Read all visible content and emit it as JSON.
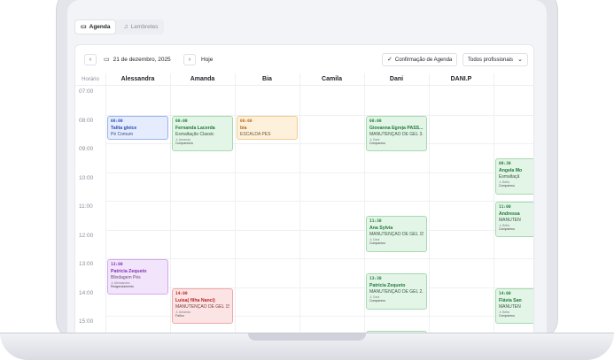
{
  "tabs": [
    {
      "label": "Agenda",
      "icon": "calendar-icon",
      "active": true
    },
    {
      "label": "Lembretes",
      "icon": "bell-icon",
      "active": false
    }
  ],
  "toolbar": {
    "prev": "‹",
    "next": "›",
    "date": "21 de dezembro, 2025",
    "today": "Hoje",
    "confirm": "Confirmação de Agenda",
    "professional_filter": "Todos profissionais"
  },
  "grid": {
    "time_header": "Horário",
    "columns": [
      "Alessandra",
      "Amanda",
      "Bia",
      "Camila",
      "Dani",
      "DANI.P",
      ""
    ],
    "times": [
      "07:00",
      "08:00",
      "09:00",
      "10:00",
      "11:00",
      "12:00",
      "13:00",
      "14:00",
      "15:00"
    ]
  },
  "events": [
    {
      "col": 0,
      "start": 8.0,
      "end": 8.9,
      "color": "blue",
      "time": "08:00",
      "name": "Talita gleice",
      "service": "Pé Comum",
      "pro": "",
      "status": ""
    },
    {
      "col": 1,
      "start": 8.0,
      "end": 9.3,
      "color": "green",
      "time": "08:00",
      "name": "Fernanda Lacerda",
      "service": "Esmaltação Classic",
      "pro": "Amanda",
      "status": "Compareceu"
    },
    {
      "col": 2,
      "start": 8.0,
      "end": 8.9,
      "color": "orange",
      "time": "08:00",
      "name": "bia",
      "service": "ESCALDA PÉS",
      "pro": "",
      "status": ""
    },
    {
      "col": 4,
      "start": 8.0,
      "end": 9.3,
      "color": "green",
      "time": "08:00",
      "name": "Giovanna Egreja PASS...",
      "service": "MANUTENÇÃO DE GEL 3...",
      "pro": "Dani",
      "status": "Comparecu"
    },
    {
      "col": 6,
      "start": 9.5,
      "end": 10.8,
      "color": "green",
      "time": "09:30",
      "name": "Angela Mo",
      "service": "Esmaltaçã",
      "pro": "Bella",
      "status": "Comparecu"
    },
    {
      "col": 6,
      "start": 11.0,
      "end": 12.3,
      "color": "green",
      "time": "11:00",
      "name": "Andressa",
      "service": "MANUTEN",
      "pro": "Bella",
      "status": "Comparecu"
    },
    {
      "col": 4,
      "start": 11.5,
      "end": 12.8,
      "color": "green",
      "time": "11:30",
      "name": "Ana Sylvia",
      "service": "MANUTENÇÃO DE GEL 15...",
      "pro": "Dani",
      "status": "Comparecu"
    },
    {
      "col": 0,
      "start": 13.0,
      "end": 14.3,
      "color": "purple",
      "time": "13:00",
      "name": "Patricia Zequeto",
      "service": "Blindagem Pés",
      "pro": "Alessandra",
      "status": "Reagendamento"
    },
    {
      "col": 4,
      "start": 13.5,
      "end": 14.8,
      "color": "green",
      "time": "13:30",
      "name": "Patricia Zequeto",
      "service": "MANUTENÇÃO DE GEL 2...",
      "pro": "Dani",
      "status": "Comparecu"
    },
    {
      "col": 1,
      "start": 14.0,
      "end": 15.3,
      "color": "red",
      "time": "14:00",
      "name": "Luisa( filha Nanci)",
      "service": "MANUTENÇÃO DE GEL 15...",
      "pro": "Amanda",
      "status": "Faltou"
    },
    {
      "col": 6,
      "start": 14.0,
      "end": 15.3,
      "color": "green",
      "time": "14:00",
      "name": "Flávia San",
      "service": "MANUTEN",
      "pro": "Bella",
      "status": "Comparecu"
    },
    {
      "col": 4,
      "start": 15.5,
      "end": 16.5,
      "color": "green",
      "time": "15:30",
      "name": "",
      "service": "",
      "pro": "",
      "status": ""
    }
  ]
}
